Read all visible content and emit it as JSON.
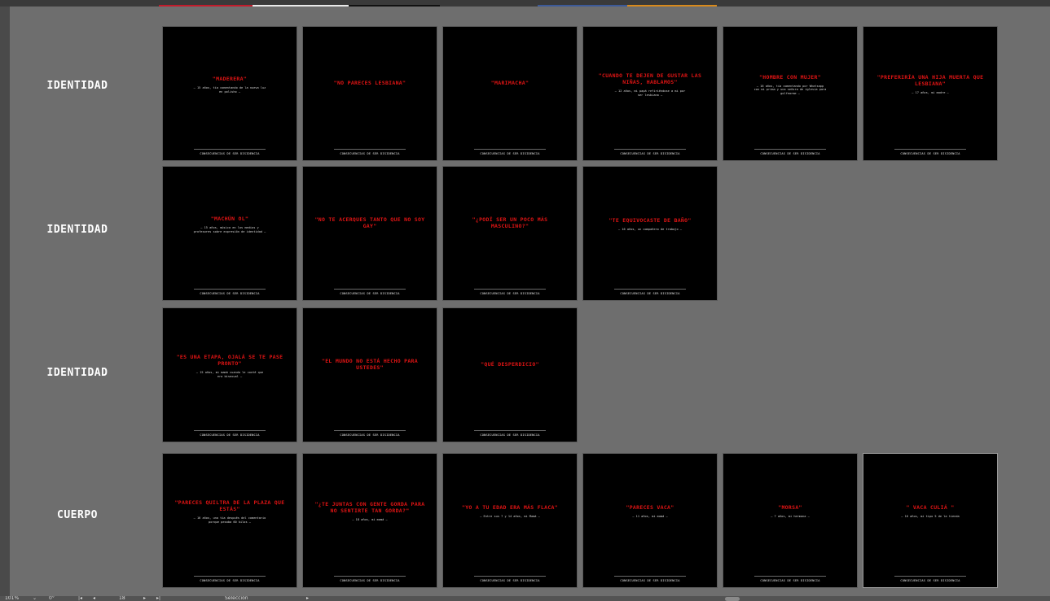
{
  "rows": [
    {
      "label": "IDENTIDAD",
      "artboards": [
        {
          "quote": "\"MADERERA\"",
          "caption": "— 15 años, tía comentando de la nueva luz en polisho —",
          "footer": "CONSECUENCIAS DE SER DISIDENCIA"
        },
        {
          "quote": "\"NO PARECES LESBIANA\"",
          "caption": "",
          "footer": "CONSECUENCIAS DE SER DISIDENCIA"
        },
        {
          "quote": "\"MARIMACHA\"",
          "caption": "",
          "footer": "CONSECUENCIAS DE SER DISIDENCIA"
        },
        {
          "quote": "\"CUANDO TE DEJEN DE GUSTAR LAS NIÑAS, HABLAMOS\"",
          "caption": "— 12 años, mi papá refiriéndose a mi por ser lesbiana —",
          "footer": "CONSECUENCIAS DE SER DISIDENCIA"
        },
        {
          "quote": "\"HOMBRE CON MUJER\"",
          "caption": "— 16 años, tía comentando por Whatsapp con mi prima y una señora de iglesia para golfearme —",
          "footer": "CONSECUENCIAS DE SER DISIDENCIA"
        },
        {
          "quote": "\"PREFERIRÍA UNA HIJA MUERTA QUE LESBIANA\"",
          "caption": "— 17 años, mi madre —",
          "footer": "CONSECUENCIAS DE SER DISIDENCIA"
        }
      ]
    },
    {
      "label": "IDENTIDAD",
      "artboards": [
        {
          "quote": "\"MACHÚN OL\"",
          "caption": "— 15 años, música en los medios y profesores sobre expresión de identidad —",
          "footer": "CONSECUENCIAS DE SER DISIDENCIA"
        },
        {
          "quote": "\"NO TE ACERQUES TANTO QUE NO SOY GAY\"",
          "caption": "",
          "footer": "CONSECUENCIAS DE SER DISIDENCIA"
        },
        {
          "quote": "\"¿PODÍ SER UN POCO MÁS MASCULINO?\"",
          "caption": "",
          "footer": "CONSECUENCIAS DE SER DISIDENCIA"
        },
        {
          "quote": "\"TE EQUIVOCASTE DE BAÑO\"",
          "caption": "— 16 años, un compañero de trabajo —",
          "footer": "CONSECUENCIAS DE SER DISIDENCIA"
        }
      ]
    },
    {
      "label": "IDENTIDAD",
      "artboards": [
        {
          "quote": "\"ES UNA ETAPA, OJALÁ SE TE PASE PRONTO\"",
          "caption": "— 15 años, mi mamá cuando le conté que era bisexual —",
          "footer": "CONSECUENCIAS DE SER DISIDENCIA"
        },
        {
          "quote": "\"EL MUNDO NO ESTÁ HECHO PARA USTEDES\"",
          "caption": "",
          "footer": "CONSECUENCIAS DE SER DISIDENCIA"
        },
        {
          "quote": "\"QUÉ DESPERDICIO\"",
          "caption": "",
          "footer": "CONSECUENCIAS DE SER DISIDENCIA"
        }
      ]
    },
    {
      "label": "CUERPO",
      "artboards": [
        {
          "quote": "\"PARECES QUILTRA DE LA PLAZA QUE ESTÁS\"",
          "caption": "— 16 años, una tía después del comentario porque pesaba 60 kilos —",
          "footer": "CONSECUENCIAS DE SER DISIDENCIA"
        },
        {
          "quote": "\"¿TE JUNTAS CON GENTE GORDA PARA NO SENTIRTE TAN GORDA?\"",
          "caption": "— 18 años, mi mamá —",
          "footer": "CONSECUENCIAS DE SER DISIDENCIA"
        },
        {
          "quote": "\"YO A TU EDAD ERA MÁS FLACA\"",
          "caption": "— Entre sus 7 y 14 años, mi Mamá —",
          "footer": "CONSECUENCIAS DE SER DISIDENCIA"
        },
        {
          "quote": "\"PARECES VACA\"",
          "caption": "— 11 años, mi mamá —",
          "footer": "CONSECUENCIAS DE SER DISIDENCIA"
        },
        {
          "quote": "\"MORSA\"",
          "caption": "— 7 años, mi hermana —",
          "footer": "CONSECUENCIAS DE SER DISIDENCIA"
        },
        {
          "quote": "\" VACA CULIÁ \"",
          "caption": "— 16 años, mi tipo 5 de la tienda",
          "footer": "CONSECUENCIAS DE SER DISIDENCIA"
        }
      ]
    }
  ],
  "status_bar": {
    "zoom": "101%",
    "rotation": "0°",
    "artboard_number": "18",
    "tool": "Selección"
  },
  "colors": {
    "pasteboard": "#6e6e6e",
    "artboard": "#000000",
    "quote": "#e01414"
  }
}
